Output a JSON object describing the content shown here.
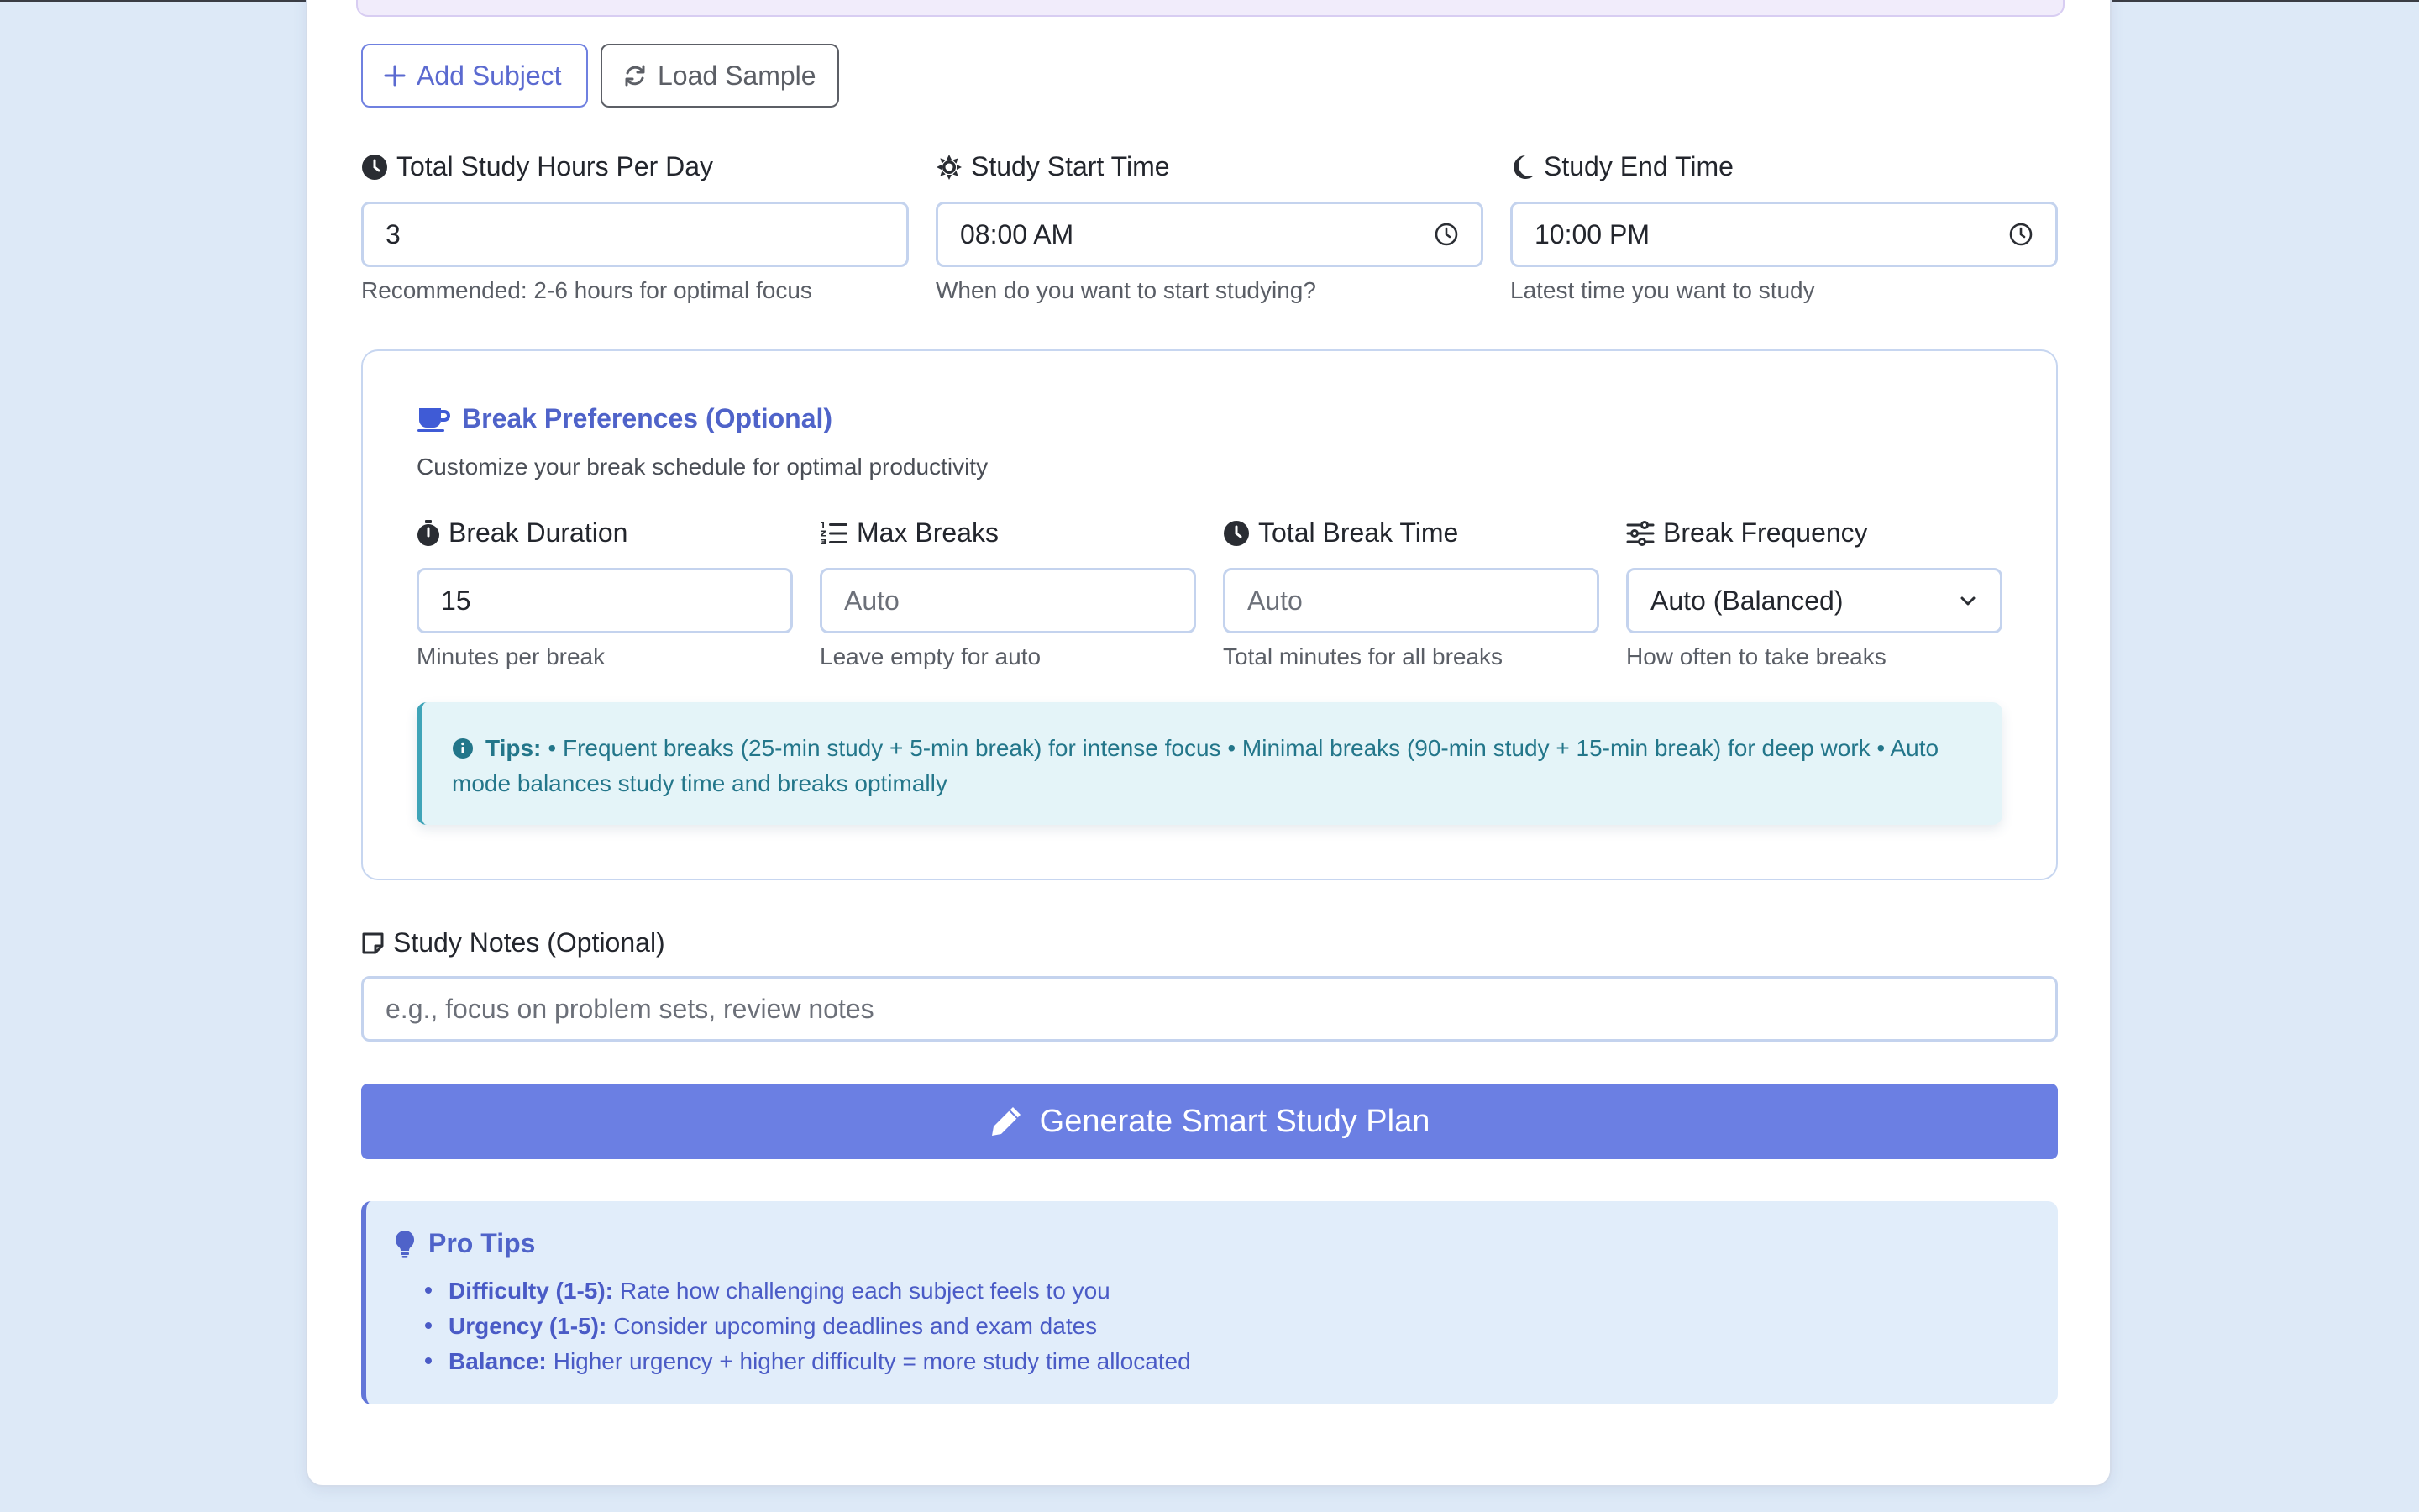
{
  "actions": {
    "add_subject": "Add Subject",
    "load_sample": "Load Sample"
  },
  "schedule": {
    "hours": {
      "label": "Total Study Hours Per Day",
      "value": "3",
      "help": "Recommended: 2-6 hours for optimal focus"
    },
    "start": {
      "label": "Study Start Time",
      "value": "08:00  AM",
      "help": "When do you want to start studying?"
    },
    "end": {
      "label": "Study End Time",
      "value": "10:00  PM",
      "help": "Latest time you want to study"
    }
  },
  "breaks": {
    "title": "Break Preferences (Optional)",
    "subtitle": "Customize your break schedule for optimal productivity",
    "duration": {
      "label": "Break Duration",
      "value": "15",
      "help": "Minutes per break"
    },
    "max": {
      "label": "Max Breaks",
      "placeholder": "Auto",
      "help": "Leave empty for auto"
    },
    "total": {
      "label": "Total Break Time",
      "placeholder": "Auto",
      "help": "Total minutes for all breaks"
    },
    "frequency": {
      "label": "Break Frequency",
      "selected": "Auto (Balanced)",
      "help": "How often to take breaks"
    },
    "tips": {
      "label": "Tips:",
      "text": "• Frequent breaks (25-min study + 5-min break) for intense focus • Minimal breaks (90-min study + 15-min break) for deep work • Auto mode balances study time and breaks optimally"
    }
  },
  "notes": {
    "label": "Study Notes (Optional)",
    "placeholder": "e.g., focus on problem sets, review notes"
  },
  "generate": {
    "label": "Generate Smart Study Plan"
  },
  "pro_tips": {
    "title": "Pro Tips",
    "items": [
      {
        "term": "Difficulty (1-5):",
        "text": "Rate how challenging each subject feels to you"
      },
      {
        "term": "Urgency (1-5):",
        "text": "Consider upcoming deadlines and exam dates"
      },
      {
        "term": "Balance:",
        "text": "Higher urgency + higher difficulty = more study time allocated"
      }
    ]
  },
  "colors": {
    "accent": "#6b7fe3",
    "accent_text": "#4f63c9",
    "page_bg": "#dde9f7",
    "tips_bg": "#e4f4f8",
    "tips_text": "#23768a"
  },
  "icons": {
    "add": "plus-icon",
    "load": "refresh-icon",
    "hours": "clock-icon",
    "start": "sun-icon",
    "end": "moon-icon",
    "breaks": "coffee-icon",
    "duration": "stopwatch-icon",
    "max": "numbered-list-icon",
    "total": "clock-icon",
    "frequency": "sliders-icon",
    "tips": "info-icon",
    "notes": "sticky-note-icon",
    "generate": "pencil-icon",
    "pro_tips": "lightbulb-icon"
  }
}
